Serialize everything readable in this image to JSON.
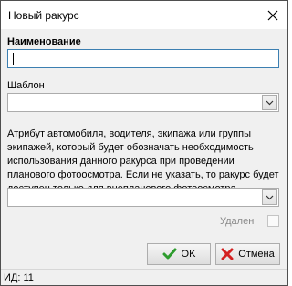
{
  "window": {
    "title": "Новый ракурс",
    "close_icon": "close-icon"
  },
  "form": {
    "name_label": "Наименование",
    "name_value": "",
    "template_label": "Шаблон",
    "template_value": "",
    "description": "Атрибут автомобиля, водителя, экипажа или группы экипажей, который будет обозначать необходимость использования данного ракурса при проведении планового фотоосмотра. Если не указать, то ракурс будет доступен только для внепланового фотоосмотра.",
    "attribute_value": "",
    "deleted_label": "Удален",
    "deleted_checked": false
  },
  "buttons": {
    "ok_label": "OK",
    "cancel_label": "Отмена"
  },
  "status": {
    "id_text": "ИД: 11"
  },
  "colors": {
    "ok_icon": "#2e9c2e",
    "cancel_icon": "#d42020",
    "focus_border": "#3c7fb1"
  }
}
